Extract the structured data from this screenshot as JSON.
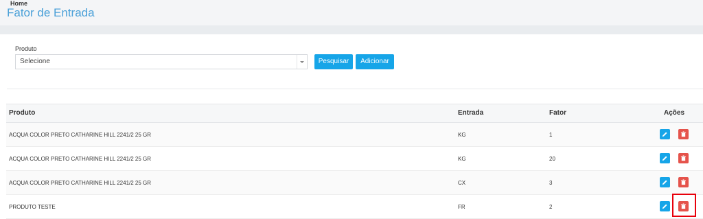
{
  "header": {
    "breadcrumb": "Home",
    "title": "Fator de Entrada"
  },
  "filter": {
    "label": "Produto",
    "select_value": "Selecione",
    "search_label": "Pesquisar",
    "add_label": "Adicionar"
  },
  "table": {
    "columns": [
      "Produto",
      "Entrada",
      "Fator",
      "Ações"
    ],
    "rows": [
      {
        "produto": "ACQUA COLOR PRETO CATHARINE HILL 2241/2 25 GR",
        "entrada": "KG",
        "fator": "1"
      },
      {
        "produto": "ACQUA COLOR PRETO CATHARINE HILL 2241/2 25 GR",
        "entrada": "KG",
        "fator": "20"
      },
      {
        "produto": "ACQUA COLOR PRETO CATHARINE HILL 2241/2 25 GR",
        "entrada": "CX",
        "fator": "3"
      },
      {
        "produto": "PRODUTO TESTE",
        "entrada": "FR",
        "fator": "2"
      }
    ],
    "edit_icon": "pencil-icon",
    "delete_icon": "trash-icon"
  },
  "colors": {
    "accent": "#16a5e8",
    "danger": "#e5534b",
    "title": "#4aa0d8",
    "highlight": "#e8000b"
  }
}
